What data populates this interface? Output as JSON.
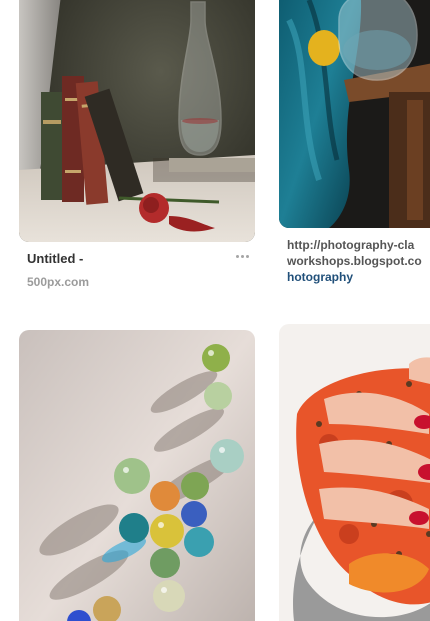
{
  "pins": [
    {
      "id": "still-life",
      "image_description": "still-life-books-carafe-rose",
      "title": "Untitled -",
      "source": "500px.com"
    },
    {
      "id": "teal-cloth",
      "image_description": "still-life-teal-cloth-lemon-carafe",
      "link_lines": [
        "http://photography-cla",
        "workshops.blogspot.co",
        "hotography"
      ]
    },
    {
      "id": "marbles",
      "image_description": "glass-marbles-with-shadows"
    },
    {
      "id": "hand-food",
      "image_description": "hand-with-red-nails-holding-food"
    }
  ],
  "colors": {
    "title": "#333333",
    "source": "#9b9b9b",
    "link": "#555555",
    "link_accent": "#21507a",
    "more_dots": "#a5a5a5"
  },
  "icons": {
    "more": "more-options-icon"
  }
}
